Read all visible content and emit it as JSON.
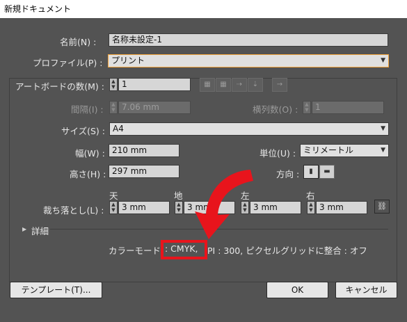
{
  "window": {
    "title": "新規ドキュメント"
  },
  "name": {
    "label": "名前(N) :",
    "value": "名称未設定-1"
  },
  "profile": {
    "label": "プロファイル(P) :",
    "value": "プリント"
  },
  "artboards": {
    "label": "アートボードの数(M) :",
    "value": "1",
    "spacing_label": "間隔(I) :",
    "spacing_value": "7.06 mm",
    "columns_label": "横列数(O) :",
    "columns_value": "1",
    "layout_icons": [
      "grid-by-row-icon",
      "grid-by-column-icon",
      "arrange-by-row-icon",
      "arrange-by-column-icon",
      "right-to-left-icon"
    ]
  },
  "size": {
    "label": "サイズ(S) :",
    "value": "A4"
  },
  "width": {
    "label": "幅(W) :",
    "value": "210 mm"
  },
  "height": {
    "label": "高さ(H) :",
    "value": "297 mm"
  },
  "units": {
    "label": "単位(U) :",
    "value": "ミリメートル"
  },
  "orientation": {
    "label": "方向 :",
    "icons": [
      "portrait-icon",
      "landscape-icon"
    ]
  },
  "bleed": {
    "label": "裁ち落とし(L) :",
    "top_label": "天",
    "top_value": "3 mm",
    "bottom_label": "地",
    "bottom_value": "3 mm",
    "left_label": "左",
    "left_value": "3 mm",
    "right_label": "右",
    "right_value": "3 mm"
  },
  "advanced": {
    "label": "詳細"
  },
  "summary": {
    "color_mode_label": "カラーモード",
    "color_mode_value": ": CMYK,",
    "rest": "PI  : 300, ピクセルグリッドに整合  : オフ"
  },
  "buttons": {
    "template": "テンプレート(T)...",
    "ok": "OK",
    "cancel": "キャンセル"
  },
  "colors": {
    "background": "#535353",
    "annotation_red": "#e8141c",
    "focus_orange": "#f2a33a"
  }
}
